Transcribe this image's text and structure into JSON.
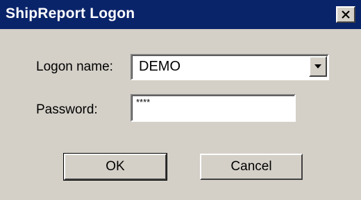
{
  "window": {
    "title": "ShipReport Logon",
    "close_icon": "close-icon",
    "colors": {
      "titlebar": "#0a246a",
      "face": "#d4d0c8"
    }
  },
  "form": {
    "logon_label": "Logon name:",
    "logon_value": "DEMO",
    "password_label": "Password:",
    "password_value": "****"
  },
  "buttons": {
    "ok": "OK",
    "cancel": "Cancel"
  }
}
